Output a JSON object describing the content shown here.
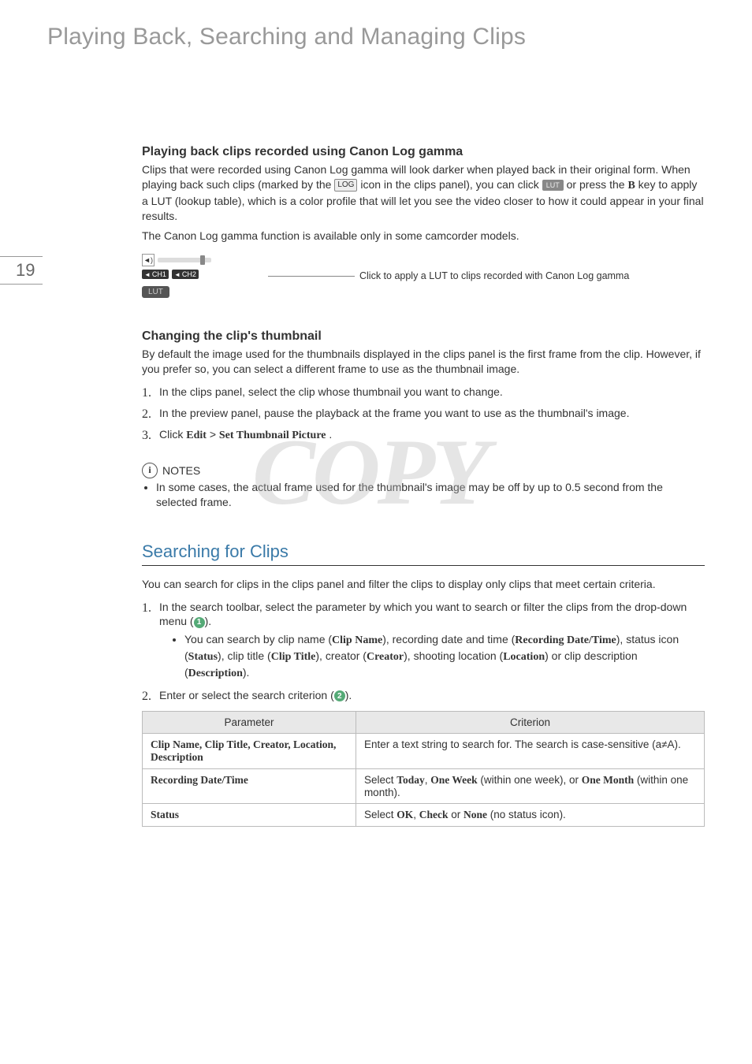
{
  "chapterTitle": "Playing Back, Searching and Managing Clips",
  "pageNumber": "19",
  "watermark": "COPY",
  "section1": {
    "heading": "Playing back clips recorded using Canon Log gamma",
    "para": "Clips that were recorded using Canon Log gamma will look darker when played back in their original form. When playing back such clips (marked by the ",
    "para_mid": " icon in the clips panel), you can click ",
    "para_end": " or press the ",
    "key": "B",
    "para_tail": " key to apply a LUT (lookup table), which is a color profile that will let you see the video closer to how it could appear in your final results.",
    "para2": "The Canon Log gamma function is available only in some camcorder models.",
    "ch1": "CH1",
    "ch2": "CH2",
    "lut": "LUT",
    "caption": "Click to apply a LUT to clips recorded with Canon Log gamma",
    "log_icon": "LOG",
    "lut_icon": "LUT"
  },
  "section2": {
    "heading": "Changing the clip's thumbnail",
    "para": "By default the image used for the thumbnails displayed in the clips panel is the first frame from the clip. However, if you prefer so, you can select a different frame to use as the thumbnail image.",
    "step1": "In the clips panel, select the clip whose thumbnail you want to change.",
    "step2": "In the preview panel, pause the playback at the frame you want to use as the thumbnail's image.",
    "step3_pre": "Click ",
    "step3_edit": "Edit",
    "step3_gt": " > ",
    "step3_cmd": "Set Thumbnail Picture",
    "step3_post": ".",
    "notes_label": "NOTES",
    "note1": "In some cases, the actual frame used for the thumbnail's image may be off by up to 0.5 second from the selected frame."
  },
  "section3": {
    "heading": "Searching for Clips",
    "para": "You can search for clips in the clips panel and filter the clips to display only clips that meet certain criteria.",
    "step1_pre": "In the search toolbar, select the parameter by which you want to search or filter the clips from the drop-down menu (",
    "step1_post": ").",
    "step1_sub_pre": "You can search by clip name (",
    "p_clipname": "Clip Name",
    "s1": "), recording date and time (",
    "p_recdate": "Recording Date/Time",
    "s2": "), status icon (",
    "p_status": "Status",
    "s3": "), clip title (",
    "p_cliptitle": "Clip Title",
    "s4": "), creator (",
    "p_creator": "Creator",
    "s5": "), shooting location (",
    "p_location": "Location",
    "s6": ") or clip description (",
    "p_desc": "Description",
    "s7": ").",
    "step2_pre": "Enter or select the search criterion (",
    "step2_post": ").",
    "circ1": "1",
    "circ2": "2"
  },
  "table": {
    "hdr_param": "Parameter",
    "hdr_crit": "Criterion",
    "row1_p": "Clip Name, Clip Title, Creator, Location, Description",
    "row1_c": "Enter a text string to search for. The search is case-sensitive (a≠A).",
    "row2_p": "Recording Date/Time",
    "row2_c_pre": "Select ",
    "row2_today": "Today",
    "row2_c_mid1": ", ",
    "row2_oneweek": "One Week",
    "row2_c_mid2": " (within one week), or ",
    "row2_onemonth": "One Month",
    "row2_c_post": " (within one month).",
    "row3_p": "Status",
    "row3_c_pre": "Select ",
    "row3_ok": "OK",
    "row3_c_mid1": ", ",
    "row3_check": "Check",
    "row3_c_mid2": " or ",
    "row3_none": "None",
    "row3_c_post": " (no status icon)."
  }
}
